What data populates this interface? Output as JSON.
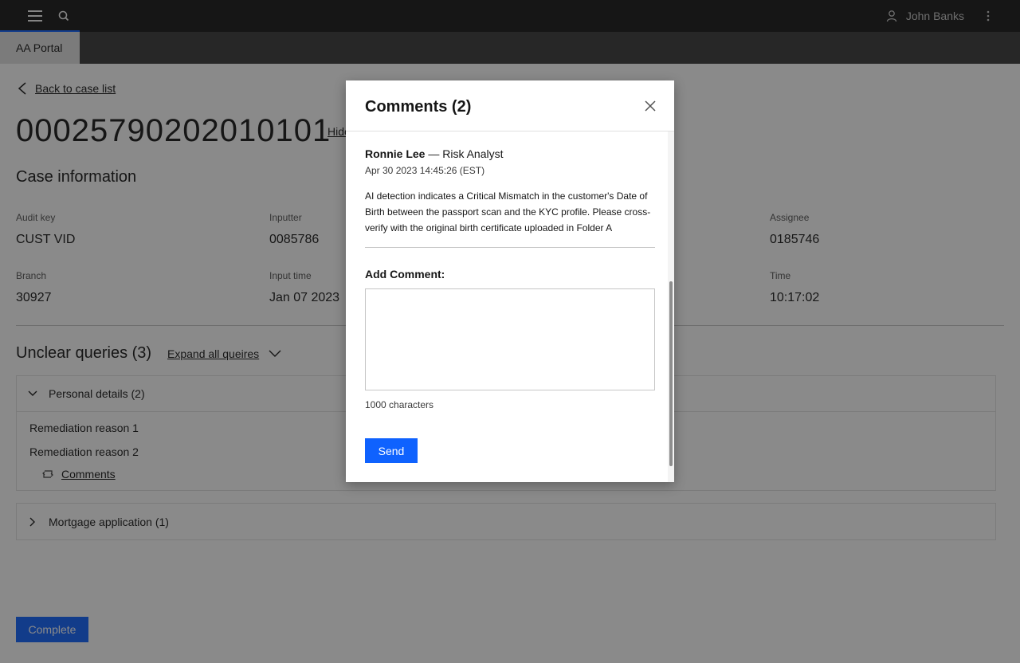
{
  "header": {
    "user_name": "John Banks",
    "icons": [
      "menu-icon",
      "search-icon",
      "user-icon",
      "kebab-icon"
    ]
  },
  "tabs": {
    "active": "AA Portal"
  },
  "page": {
    "back_label": "Back to case list",
    "case_id": "00025790202010101",
    "hide_label": "Hide",
    "section_title": "Case information",
    "fields": {
      "audit_key": {
        "label": "Audit key",
        "value": "CUST VID"
      },
      "inputter": {
        "label": "Inputter",
        "value": "0085786"
      },
      "assignee": {
        "label": "Assignee",
        "value": "0185746"
      },
      "branch": {
        "label": "Branch",
        "value": "30927"
      },
      "input_time": {
        "label": "Input time",
        "value": "Jan 07 2023"
      },
      "time": {
        "label": "Time",
        "value": "10:17:02"
      }
    },
    "unclear_title": "Unclear queries (3)",
    "expand_all_label": "Expand all queires",
    "accordion": [
      {
        "title": "Personal details (2)",
        "reasons": [
          "Remediation reason 1",
          "Remediation reason 2"
        ],
        "comments_label": "Comments"
      },
      {
        "title": "Mortgage application (1)"
      }
    ],
    "complete_label": "Complete"
  },
  "modal": {
    "title": "Comments (2)",
    "comment": {
      "author": "Ronnie Lee",
      "role": "Risk Analyst",
      "timestamp": "Apr 30 2023 14:45:26 (EST)",
      "text": "AI detection indicates a Critical Mismatch in the customer's Date of Birth between the passport scan and the KYC profile. Please cross-verify with the original birth certificate uploaded in Folder A"
    },
    "add_label": "Add Comment:",
    "textarea_value": "",
    "chars_label": "1000 characters",
    "send_label": "Send"
  },
  "colors": {
    "primary": "#0f62fe",
    "topbar": "#161616",
    "tabbar": "#393939"
  }
}
